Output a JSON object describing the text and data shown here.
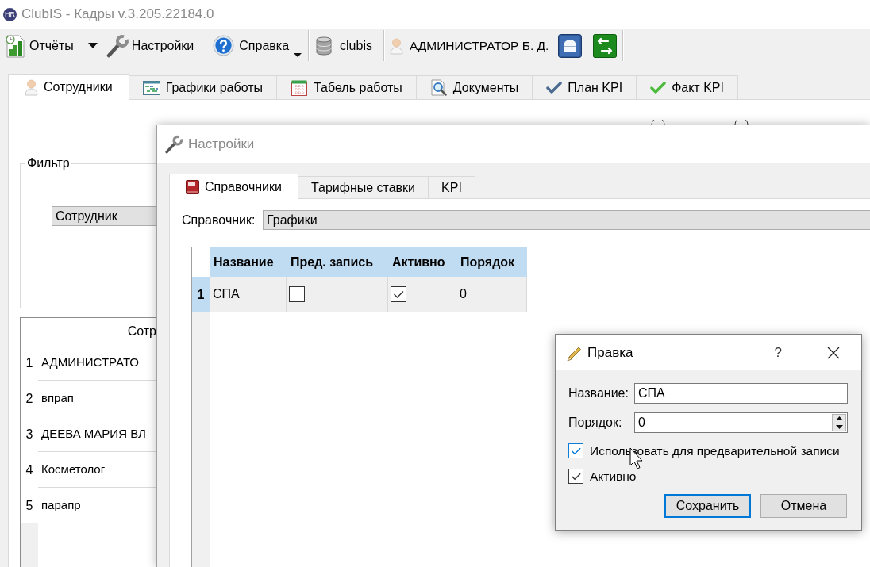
{
  "window": {
    "logo": "HR",
    "title": "ClubIS - Кадры v.3.205.22184.0"
  },
  "toolbar": {
    "reports": {
      "label": "Отчёты"
    },
    "settings": {
      "label": "Настройки"
    },
    "help": {
      "label": "Справка"
    },
    "database": {
      "label": "clubis"
    },
    "user": {
      "label": "АДМИНИСТРАТОР Б. Д."
    }
  },
  "tabs": [
    {
      "label": "Сотрудники",
      "selected": true
    },
    {
      "label": "Графики работы",
      "selected": false
    },
    {
      "label": "Табель работы",
      "selected": false
    },
    {
      "label": "Документы",
      "selected": false
    },
    {
      "label": "План KPI",
      "selected": false
    },
    {
      "label": "Факт KPI",
      "selected": false
    }
  ],
  "filter": {
    "title": "Фильтр",
    "field": {
      "value": "Сотрудник"
    }
  },
  "employees_table": {
    "columns": [
      "Сотр"
    ],
    "rows": [
      {
        "number": "1",
        "name": "АДМИНИСТРАТО"
      },
      {
        "number": "2",
        "name": "впрап"
      },
      {
        "number": "3",
        "name": "ДЕЕВА МАРИЯ ВЛ"
      },
      {
        "number": "4",
        "name": "Косметолог"
      },
      {
        "number": "5",
        "name": "парапр"
      }
    ]
  },
  "settings_window": {
    "title": "Настройки",
    "tabs": [
      {
        "label": "Справочники",
        "selected": true
      },
      {
        "label": "Тарифные ставки",
        "selected": false
      },
      {
        "label": "KPI",
        "selected": false
      }
    ],
    "directory": {
      "label": "Справочник:",
      "value": "Графики"
    },
    "table": {
      "columns": [
        "Название",
        "Пред. запись",
        "Активно",
        "Порядок"
      ],
      "rows": [
        {
          "number": "1",
          "name": "СПА",
          "pre_booking": false,
          "active": true,
          "order": "0",
          "selected": true
        }
      ]
    }
  },
  "edit_dialog": {
    "title": "Правка",
    "help": "?",
    "fields": [
      {
        "kind": "text",
        "label": "Название:",
        "value": "СПА"
      },
      {
        "kind": "spin",
        "label": "Порядок:",
        "value": "0"
      }
    ],
    "checkboxes": [
      {
        "label": "Использовать для предварительной записи",
        "checked": true,
        "focused": true
      },
      {
        "label": "Активно",
        "checked": true,
        "focused": false
      }
    ],
    "buttons": [
      {
        "label": "Сохранить",
        "default": true
      },
      {
        "label": "Отмена",
        "default": false
      }
    ]
  }
}
